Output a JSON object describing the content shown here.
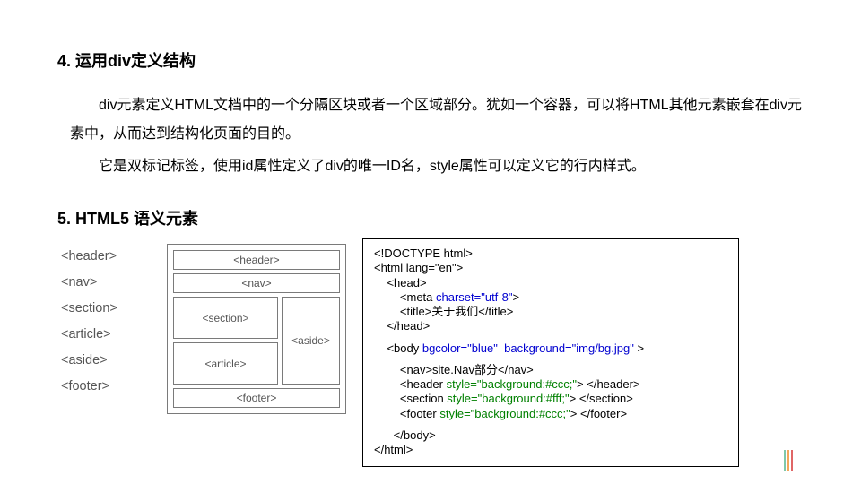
{
  "heading4": "4. 运用div定义结构",
  "para1": "div元素定义HTML文档中的一个分隔区块或者一个区域部分。犹如一个容器，可以将HTML其他元素嵌套在div元素中，从而达到结构化页面的目的。",
  "para2": "它是双标记标签，使用id属性定义了div的唯一ID名，style属性可以定义它的行内样式。",
  "heading5": "5. HTML5 语义元素",
  "tags": [
    "<header>",
    "<nav>",
    "<section>",
    "<article>",
    "<aside>",
    "<footer>"
  ],
  "diagram": {
    "header": "<header>",
    "nav": "<nav>",
    "section": "<section>",
    "article": "<article>",
    "aside": "<aside>",
    "footer": "<footer>"
  },
  "code": {
    "l1": "<!DOCTYPE html>",
    "l2": "<html lang=\"en\">",
    "l3": "    <head>",
    "l4a": "        <meta ",
    "l4b": "charset=\"utf-8\"",
    "l4c": ">",
    "l5": "        <title>关于我们</title>",
    "l6": "    </head>",
    "l7a": "    <body ",
    "l7b": "bgcolor=\"blue\"  background=\"img/bg.jpg\"",
    "l7c": " >",
    "l8a": "        <nav>",
    "l8b": "site.Nav部分",
    "l8c": "</nav>",
    "l9a": "        <header ",
    "l9b": "style=\"background:#ccc;\"",
    "l9c": "> </header>",
    "l10a": "        <section ",
    "l10b": "style=\"background:#fff;\"",
    "l10c": "> </section>",
    "l11a": "        <footer ",
    "l11b": "style=\"background:#ccc;\"",
    "l11c": "> </footer>",
    "l12": "      </body>",
    "l13": "</html>"
  }
}
